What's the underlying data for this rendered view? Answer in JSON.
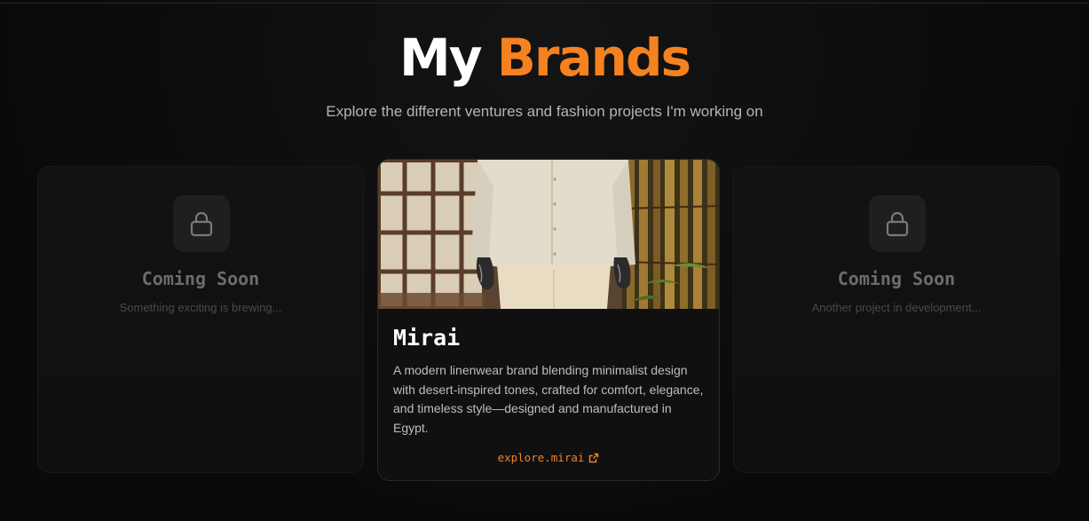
{
  "header": {
    "title_word_1": "My",
    "title_word_2": "Brands",
    "subtitle": "Explore the different ventures and fashion projects I'm working on"
  },
  "cards": {
    "left": {
      "icon": "lock-icon",
      "title": "Coming Soon",
      "subtitle": "Something exciting is brewing..."
    },
    "featured": {
      "image": "brand-photo",
      "name": "Mirai",
      "description": "A modern linenwear brand blending minimalist design with desert-inspired tones, crafted for comfort, elegance, and timeless style—designed and manufactured in Egypt.",
      "link_label": "explore.mirai",
      "link_icon": "external-link-icon"
    },
    "right": {
      "icon": "lock-icon",
      "title": "Coming Soon",
      "subtitle": "Another project in development..."
    }
  },
  "colors": {
    "accent": "#f58220",
    "background": "#0b0b0b",
    "card": "#111111"
  }
}
